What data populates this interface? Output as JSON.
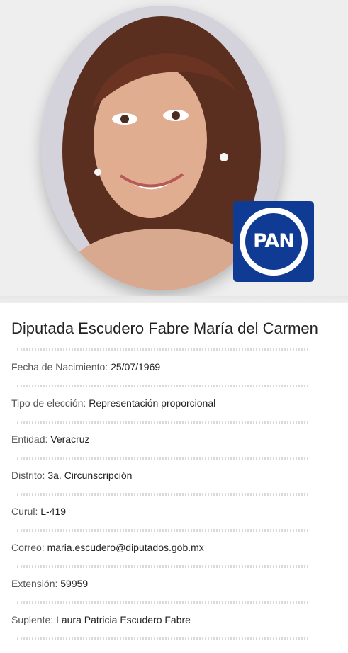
{
  "title": "Diputada Escudero Fabre María del Carmen",
  "party_logo_text": "PAN",
  "fields": [
    {
      "label": "Fecha de Nacimiento:",
      "value": "25/07/1969"
    },
    {
      "label": "Tipo de elección:",
      "value": "Representación proporcional"
    },
    {
      "label": "Entidad:",
      "value": "Veracruz"
    },
    {
      "label": "Distrito:",
      "value": "3a. Circunscripción"
    },
    {
      "label": "Curul:",
      "value": "L-419"
    },
    {
      "label": "Correo:",
      "value": "maria.escudero@diputados.gob.mx"
    },
    {
      "label": "Extensión:",
      "value": "59959"
    },
    {
      "label": "Suplente:",
      "value": "Laura Patricia Escudero Fabre"
    }
  ],
  "colors": {
    "hero_background": "#eeeeef",
    "party_blue": "#0f3b95",
    "divider": "#d9d9d9"
  },
  "icons": {
    "portrait": "deputy-portrait",
    "party": "pan-logo-icon"
  }
}
